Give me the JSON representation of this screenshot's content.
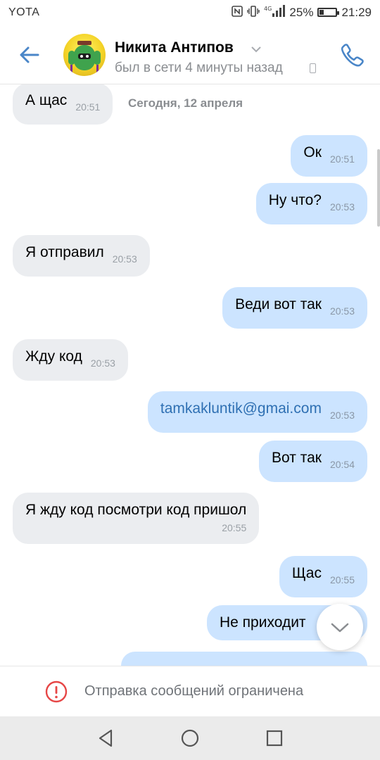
{
  "status_bar": {
    "carrier": "YOTA",
    "icons": [
      "nfc-icon",
      "vibrate-icon",
      "4g-signal-icon",
      "battery-icon"
    ],
    "network": "4G",
    "battery": "25%",
    "battery_level": 0.25,
    "time": "21:29"
  },
  "header": {
    "contact_name": "Никита Антипов",
    "last_seen": "был в сети 4 минуты назад",
    "back_icon": "arrow-left-icon",
    "call_icon": "phone-icon"
  },
  "chat": {
    "date_label": "Сегодня, 12 апреля",
    "messages": [
      {
        "side": "in",
        "text": "А щас",
        "time": "20:51"
      },
      {
        "side": "out",
        "text": "Ок",
        "time": "20:51"
      },
      {
        "side": "out",
        "text": "Ну что?",
        "time": "20:53"
      },
      {
        "side": "in",
        "text": "Я отправил",
        "time": "20:53"
      },
      {
        "side": "out",
        "text": "Веди вот так",
        "time": "20:53"
      },
      {
        "side": "in",
        "text": "Жду код",
        "time": "20:53"
      },
      {
        "side": "out",
        "text": "tamkakluntik@gmai.com",
        "time": "20:53"
      },
      {
        "side": "out",
        "text": "Вот так",
        "time": "20:54"
      },
      {
        "side": "in",
        "text": "Я жду код посмотри код пришол",
        "time": "20:55"
      },
      {
        "side": "out",
        "text": "Щас",
        "time": "20:55"
      },
      {
        "side": "out",
        "text": "Не приходит",
        "time": ""
      }
    ]
  },
  "restriction": {
    "text": "Отправка сообщений ограничена",
    "icon": "warning-circle-icon",
    "color": "#e64646"
  },
  "colors": {
    "accent": "#4a86c8",
    "incoming_bubble": "#ebedf0",
    "outgoing_bubble": "#cce4ff"
  }
}
